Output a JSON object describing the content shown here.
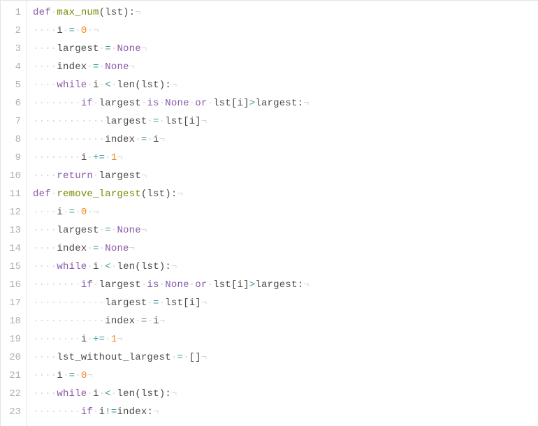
{
  "lines": [
    {
      "n": 1,
      "tokens": [
        [
          "kw",
          "def"
        ],
        [
          "ws",
          " "
        ],
        [
          "fn",
          "max_num"
        ],
        [
          "punc",
          "("
        ],
        [
          "var",
          "lst"
        ],
        [
          "punc",
          ")"
        ],
        [
          "punc",
          ":"
        ],
        [
          "eol",
          ""
        ]
      ]
    },
    {
      "n": 2,
      "indent": 4,
      "tokens": [
        [
          "var",
          "i"
        ],
        [
          "ws",
          " "
        ],
        [
          "op",
          "="
        ],
        [
          "ws",
          " "
        ],
        [
          "num",
          "0"
        ],
        [
          "ws",
          " "
        ],
        [
          "eol",
          ""
        ]
      ]
    },
    {
      "n": 3,
      "indent": 4,
      "tokens": [
        [
          "var",
          "largest"
        ],
        [
          "ws",
          " "
        ],
        [
          "op",
          "="
        ],
        [
          "ws",
          " "
        ],
        [
          "none",
          "None"
        ],
        [
          "eol",
          ""
        ]
      ]
    },
    {
      "n": 4,
      "indent": 4,
      "tokens": [
        [
          "var",
          "index"
        ],
        [
          "ws",
          " "
        ],
        [
          "op",
          "="
        ],
        [
          "ws",
          " "
        ],
        [
          "none",
          "None"
        ],
        [
          "eol",
          ""
        ]
      ]
    },
    {
      "n": 5,
      "indent": 4,
      "tokens": [
        [
          "kw",
          "while"
        ],
        [
          "ws",
          " "
        ],
        [
          "var",
          "i"
        ],
        [
          "ws",
          " "
        ],
        [
          "op",
          "<"
        ],
        [
          "ws",
          " "
        ],
        [
          "var",
          "len"
        ],
        [
          "punc",
          "("
        ],
        [
          "var",
          "lst"
        ],
        [
          "punc",
          ")"
        ],
        [
          "punc",
          ":"
        ],
        [
          "eol",
          ""
        ]
      ]
    },
    {
      "n": 6,
      "indent": 8,
      "tokens": [
        [
          "kw",
          "if"
        ],
        [
          "ws",
          " "
        ],
        [
          "var",
          "largest"
        ],
        [
          "ws",
          " "
        ],
        [
          "kw",
          "is"
        ],
        [
          "ws",
          " "
        ],
        [
          "none",
          "None"
        ],
        [
          "ws",
          " "
        ],
        [
          "kw",
          "or"
        ],
        [
          "ws",
          " "
        ],
        [
          "var",
          "lst"
        ],
        [
          "punc",
          "["
        ],
        [
          "var",
          "i"
        ],
        [
          "punc",
          "]"
        ],
        [
          "op",
          ">"
        ],
        [
          "var",
          "largest"
        ],
        [
          "punc",
          ":"
        ],
        [
          "eol",
          ""
        ]
      ]
    },
    {
      "n": 7,
      "indent": 12,
      "tokens": [
        [
          "var",
          "largest"
        ],
        [
          "ws",
          " "
        ],
        [
          "op",
          "="
        ],
        [
          "ws",
          " "
        ],
        [
          "var",
          "lst"
        ],
        [
          "punc",
          "["
        ],
        [
          "var",
          "i"
        ],
        [
          "punc",
          "]"
        ],
        [
          "eol",
          ""
        ]
      ]
    },
    {
      "n": 8,
      "indent": 12,
      "tokens": [
        [
          "var",
          "index"
        ],
        [
          "ws",
          " "
        ],
        [
          "op",
          "="
        ],
        [
          "ws",
          " "
        ],
        [
          "var",
          "i"
        ],
        [
          "eol",
          ""
        ]
      ]
    },
    {
      "n": 9,
      "indent": 8,
      "tokens": [
        [
          "var",
          "i"
        ],
        [
          "ws",
          " "
        ],
        [
          "op",
          "+="
        ],
        [
          "ws",
          " "
        ],
        [
          "num",
          "1"
        ],
        [
          "eol",
          ""
        ]
      ]
    },
    {
      "n": 10,
      "indent": 4,
      "tokens": [
        [
          "kw",
          "return"
        ],
        [
          "ws",
          " "
        ],
        [
          "var",
          "largest"
        ],
        [
          "eol",
          ""
        ]
      ]
    },
    {
      "n": 11,
      "tokens": [
        [
          "kw",
          "def"
        ],
        [
          "ws",
          " "
        ],
        [
          "fn",
          "remove_largest"
        ],
        [
          "punc",
          "("
        ],
        [
          "var",
          "lst"
        ],
        [
          "punc",
          ")"
        ],
        [
          "punc",
          ":"
        ],
        [
          "eol",
          ""
        ]
      ]
    },
    {
      "n": 12,
      "indent": 4,
      "tokens": [
        [
          "var",
          "i"
        ],
        [
          "ws",
          " "
        ],
        [
          "op",
          "="
        ],
        [
          "ws",
          " "
        ],
        [
          "num",
          "0"
        ],
        [
          "ws",
          " "
        ],
        [
          "eol",
          ""
        ]
      ]
    },
    {
      "n": 13,
      "indent": 4,
      "tokens": [
        [
          "var",
          "largest"
        ],
        [
          "ws",
          " "
        ],
        [
          "op",
          "="
        ],
        [
          "ws",
          " "
        ],
        [
          "none",
          "None"
        ],
        [
          "eol",
          ""
        ]
      ]
    },
    {
      "n": 14,
      "indent": 4,
      "tokens": [
        [
          "var",
          "index"
        ],
        [
          "ws",
          " "
        ],
        [
          "op",
          "="
        ],
        [
          "ws",
          " "
        ],
        [
          "none",
          "None"
        ],
        [
          "eol",
          ""
        ]
      ]
    },
    {
      "n": 15,
      "indent": 4,
      "tokens": [
        [
          "kw",
          "while"
        ],
        [
          "ws",
          " "
        ],
        [
          "var",
          "i"
        ],
        [
          "ws",
          " "
        ],
        [
          "op",
          "<"
        ],
        [
          "ws",
          " "
        ],
        [
          "var",
          "len"
        ],
        [
          "punc",
          "("
        ],
        [
          "var",
          "lst"
        ],
        [
          "punc",
          ")"
        ],
        [
          "punc",
          ":"
        ],
        [
          "eol",
          ""
        ]
      ]
    },
    {
      "n": 16,
      "indent": 8,
      "tokens": [
        [
          "kw",
          "if"
        ],
        [
          "ws",
          " "
        ],
        [
          "var",
          "largest"
        ],
        [
          "ws",
          " "
        ],
        [
          "kw",
          "is"
        ],
        [
          "ws",
          " "
        ],
        [
          "none",
          "None"
        ],
        [
          "ws",
          " "
        ],
        [
          "kw",
          "or"
        ],
        [
          "ws",
          " "
        ],
        [
          "var",
          "lst"
        ],
        [
          "punc",
          "["
        ],
        [
          "var",
          "i"
        ],
        [
          "punc",
          "]"
        ],
        [
          "op",
          ">"
        ],
        [
          "var",
          "largest"
        ],
        [
          "punc",
          ":"
        ],
        [
          "eol",
          ""
        ]
      ]
    },
    {
      "n": 17,
      "indent": 12,
      "tokens": [
        [
          "var",
          "largest"
        ],
        [
          "ws",
          " "
        ],
        [
          "op",
          "="
        ],
        [
          "ws",
          " "
        ],
        [
          "var",
          "lst"
        ],
        [
          "punc",
          "["
        ],
        [
          "var",
          "i"
        ],
        [
          "punc",
          "]"
        ],
        [
          "eol",
          ""
        ]
      ]
    },
    {
      "n": 18,
      "indent": 12,
      "tokens": [
        [
          "var",
          "index"
        ],
        [
          "ws",
          " "
        ],
        [
          "op",
          "="
        ],
        [
          "ws",
          " "
        ],
        [
          "var",
          "i"
        ],
        [
          "eol",
          ""
        ]
      ]
    },
    {
      "n": 19,
      "indent": 8,
      "tokens": [
        [
          "var",
          "i"
        ],
        [
          "ws",
          " "
        ],
        [
          "op",
          "+="
        ],
        [
          "ws",
          " "
        ],
        [
          "num",
          "1"
        ],
        [
          "eol",
          ""
        ]
      ]
    },
    {
      "n": 20,
      "indent": 4,
      "tokens": [
        [
          "var",
          "lst_without_largest"
        ],
        [
          "ws",
          " "
        ],
        [
          "op",
          "="
        ],
        [
          "ws",
          " "
        ],
        [
          "punc",
          "["
        ],
        [
          "punc",
          "]"
        ],
        [
          "eol",
          ""
        ]
      ]
    },
    {
      "n": 21,
      "indent": 4,
      "tokens": [
        [
          "var",
          "i"
        ],
        [
          "ws",
          " "
        ],
        [
          "op",
          "="
        ],
        [
          "ws",
          " "
        ],
        [
          "num",
          "0"
        ],
        [
          "eol",
          ""
        ]
      ]
    },
    {
      "n": 22,
      "indent": 4,
      "tokens": [
        [
          "kw",
          "while"
        ],
        [
          "ws",
          " "
        ],
        [
          "var",
          "i"
        ],
        [
          "ws",
          " "
        ],
        [
          "op",
          "<"
        ],
        [
          "ws",
          " "
        ],
        [
          "var",
          "len"
        ],
        [
          "punc",
          "("
        ],
        [
          "var",
          "lst"
        ],
        [
          "punc",
          ")"
        ],
        [
          "punc",
          ":"
        ],
        [
          "eol",
          ""
        ]
      ]
    },
    {
      "n": 23,
      "indent": 8,
      "tokens": [
        [
          "kw",
          "if"
        ],
        [
          "ws",
          " "
        ],
        [
          "var",
          "i"
        ],
        [
          "op",
          "!="
        ],
        [
          "var",
          "index"
        ],
        [
          "punc",
          ":"
        ],
        [
          "eol",
          ""
        ]
      ]
    }
  ],
  "glyphs": {
    "dot": "·",
    "eol": "¬"
  }
}
